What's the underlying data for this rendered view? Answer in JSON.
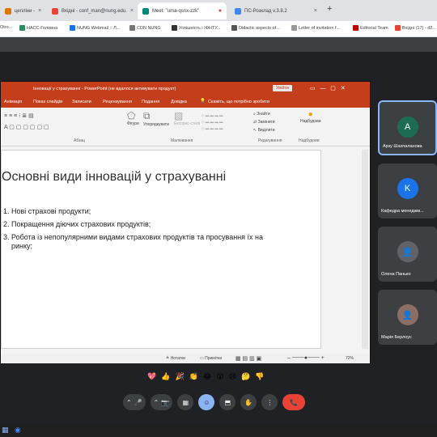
{
  "browser": {
    "tabs": [
      {
        "label": "цепліни - ",
        "color": "#e37400",
        "active": false
      },
      {
        "label": "Вхідні - conf_man@nung.edu.",
        "color": "#ea4335",
        "active": false
      },
      {
        "label": "Meet: \"uma-qsnx-zzk\"",
        "color": "#00897b",
        "active": true
      },
      {
        "label": "ПС-Розклад v.3.8.2",
        "color": "#4285f4",
        "active": false
      }
    ],
    "new_tab": "+",
    "bookmarks": [
      "Otro...",
      "НАСС-Головна",
      "NUNG Webmail :: Л...",
      "CDN NUNG",
      "Успішність і ІФНТУ...",
      "Didactic aspects of...",
      "Letter of invitation f...",
      "Editorial Team",
      "Вхідні (17) - d2..."
    ]
  },
  "powerpoint": {
    "title": "Інновації у страхуванні  -  PowerPoint (не вдалося активувати продукт)",
    "title_button": "Увійти",
    "tabs": [
      "Анімація",
      "Показ слайдів",
      "Записати",
      "Рецензування",
      "Подання",
      "Довідка",
      "Скажіть, що потрібно зробити"
    ],
    "ribbon_groups": [
      "Абзац",
      "Малювання",
      "Редагування",
      "Надбудови"
    ],
    "ribbon_items": [
      "Фігури",
      "Упорядкувати",
      "Експрес-стилі",
      "Знайти",
      "Замінити",
      "Виділити",
      "Надбудови"
    ],
    "slide": {
      "title": "Основні види інновацій у страхуванні",
      "bullets": [
        {
          "num": "1.",
          "text": "Нові страхові продукти;"
        },
        {
          "num": "2.",
          "text": "Покращення діючих страхових продуктів;"
        },
        {
          "num": "3.",
          "text": "Робота із непопулярними видами страхових продуктів та просування їх на ринку;"
        }
      ]
    },
    "status": {
      "notes": "Нотатки",
      "comments": "Примітки",
      "zoom": "72%"
    }
  },
  "participants": [
    {
      "initial": "A",
      "name": "Арзу Шахпаланова",
      "color": "#1e6b54",
      "active": true
    },
    {
      "initial": "K",
      "name": "Кафедра менеджм...",
      "color": "#1a73e8",
      "active": false
    },
    {
      "initial": "",
      "name": "Олена Панько",
      "color": "#5f6368",
      "active": false
    },
    {
      "initial": "",
      "name": "Марія Берлоус",
      "color": "#8d6e63",
      "active": false
    }
  ],
  "reactions": [
    "💖",
    "👍",
    "🎉",
    "👏",
    "😂",
    "😮",
    "😢",
    "🤔",
    "👎"
  ],
  "controls": [
    "⌃",
    "🎤",
    "⌃",
    "📷",
    "▦",
    "☺",
    "⬒",
    "✋",
    "⋮",
    "📞"
  ]
}
